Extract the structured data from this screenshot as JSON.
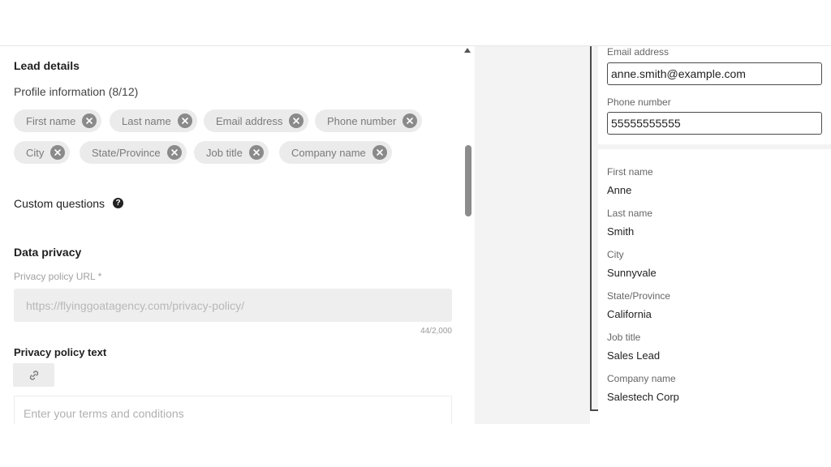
{
  "lead_details": {
    "title": "Lead details",
    "profile_info_label": "Profile information (8/12)",
    "chips": [
      {
        "label": "First name"
      },
      {
        "label": "Last name"
      },
      {
        "label": "Email address"
      },
      {
        "label": "Phone number"
      },
      {
        "label": "City"
      },
      {
        "label": "State/Province"
      },
      {
        "label": "Job title"
      },
      {
        "label": "Company name"
      }
    ],
    "custom_questions_label": "Custom questions"
  },
  "data_privacy": {
    "title": "Data privacy",
    "url_label": "Privacy policy URL *",
    "url_value": "https://flyinggoatagency.com/privacy-policy/",
    "url_counter": "44/2,000",
    "text_label": "Privacy policy text",
    "terms_placeholder": "Enter your terms and conditions"
  },
  "preview": {
    "email_label": "Email address",
    "email_value": "anne.smith@example.com",
    "phone_label": "Phone number",
    "phone_value": "55555555555",
    "fields": [
      {
        "label": "First name",
        "value": "Anne"
      },
      {
        "label": "Last name",
        "value": "Smith"
      },
      {
        "label": "City",
        "value": "Sunnyvale"
      },
      {
        "label": "State/Province",
        "value": "California"
      },
      {
        "label": "Job title",
        "value": "Sales Lead"
      },
      {
        "label": "Company name",
        "value": "Salestech Corp"
      }
    ]
  }
}
